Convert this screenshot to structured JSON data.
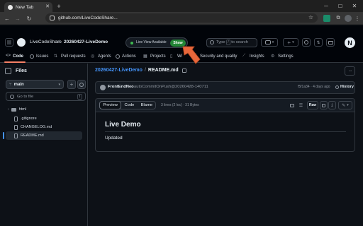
{
  "browser": {
    "tab_title": "New Tab",
    "url": "github.com/LiveCodeShare..."
  },
  "header": {
    "org": "LiveCodeShare",
    "separator": "/",
    "repo": "20260427-LiveDemo",
    "live_view_label": "Live View Available",
    "show_button": "Show",
    "search_placeholder": "Type / to search",
    "search_key": "/",
    "avatar_letter": "N"
  },
  "nav": {
    "tabs": [
      {
        "label": "Code"
      },
      {
        "label": "Issues"
      },
      {
        "label": "Pull requests"
      },
      {
        "label": "Agents"
      },
      {
        "label": "Actions"
      },
      {
        "label": "Projects"
      },
      {
        "label": "Wi"
      },
      {
        "label": "Security and quality"
      },
      {
        "label": "Insights"
      },
      {
        "label": "Settings"
      }
    ]
  },
  "sidebar": {
    "title": "Files",
    "branch": "main",
    "goto_placeholder": "Go to file",
    "goto_key": "t",
    "items": [
      {
        "label": "html",
        "type": "folder"
      },
      {
        "label": ".gitignore",
        "type": "file"
      },
      {
        "label": "CHANGELOG.md",
        "type": "file"
      },
      {
        "label": "README.md",
        "type": "file"
      }
    ]
  },
  "main": {
    "breadcrumb_repo": "20260427-LiveDemo",
    "breadcrumb_sep": "/",
    "breadcrumb_file": "README.md",
    "commit": {
      "author": "FrontEndNeo",
      "message": "autoCommitOnPush@20260428-140711",
      "sha_time": "f5f1a34 · 4 days ago",
      "history_label": "History"
    },
    "file_toolbar": {
      "tab_preview": "Preview",
      "tab_code": "Code",
      "tab_blame": "Blame",
      "stats": "3 lines (2 loc) · 31 Bytes",
      "raw_label": "Raw"
    },
    "readme": {
      "heading": "Live Demo",
      "body": "Updated"
    }
  },
  "colors": {
    "accent_blue": "#4493f8",
    "green": "#238636",
    "orange_arrow": "#e8673b"
  }
}
